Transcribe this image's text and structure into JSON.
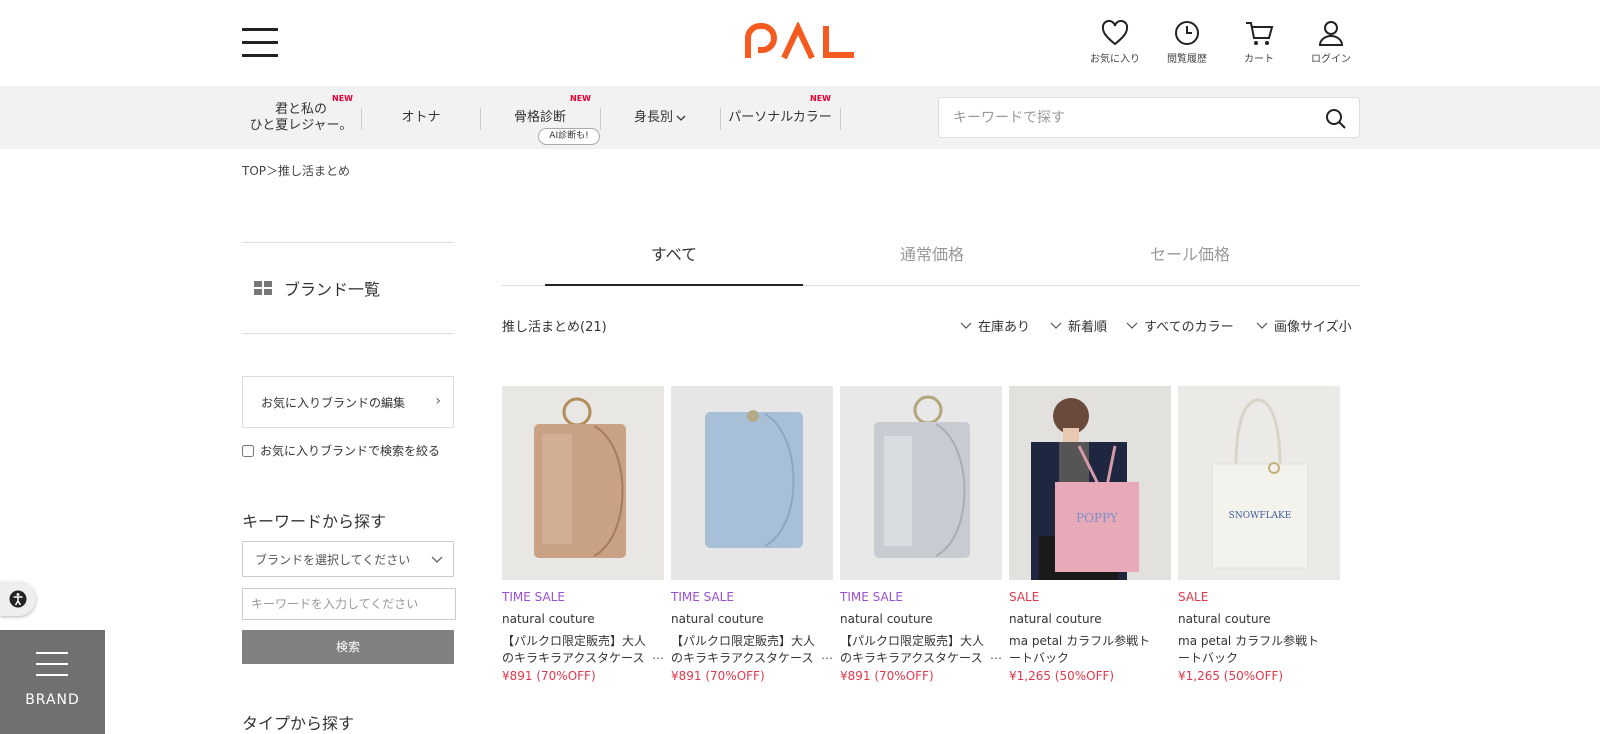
{
  "header": {
    "logo_text": "PAL",
    "icons": [
      {
        "name": "favorite",
        "label": "お気に入り"
      },
      {
        "name": "history",
        "label": "閲覧履歴"
      },
      {
        "name": "cart",
        "label": "カート"
      },
      {
        "name": "login",
        "label": "ログイン"
      }
    ]
  },
  "nav": {
    "items": [
      {
        "label": "君と私の\nひと夏レジャー。",
        "new": true
      },
      {
        "label": "オトナ",
        "new": false
      },
      {
        "label": "骨格診断",
        "new": true
      },
      {
        "label": "身長別",
        "new": false
      },
      {
        "label": "パーソナルカラー",
        "new": true
      }
    ],
    "new_label": "NEW",
    "ai_badge": "AI診断も!",
    "search_placeholder": "キーワードで探す"
  },
  "breadcrumb": "TOP＞推し活まとめ",
  "sidebar": {
    "brand_list": "ブランド一覧",
    "fav_edit": "お気に入りブランドの編集",
    "fav_filter": "お気に入りブランドで検索を絞る",
    "keyword_heading": "キーワードから探す",
    "brand_select_placeholder": "ブランドを選択してください",
    "keyword_placeholder": "キーワードを入力してください",
    "search_button": "検索",
    "type_heading": "タイプから探す"
  },
  "fab": {
    "brand_label": "BRAND"
  },
  "tabs": [
    "すべて",
    "通常価格",
    "セール価格"
  ],
  "result_count": "推し活まとめ(21)",
  "filters": [
    "在庫あり",
    "新着順",
    "すべてのカラー",
    "画像サイズ小"
  ],
  "products": [
    {
      "tag": "TIME SALE",
      "tag_type": "ts",
      "brand": "natural couture",
      "name": "【パルクロ限定販売】大人のキラキラアクスタケース",
      "price": "¥891 (70%OFF)",
      "image": "rose-gold-card-case",
      "color": "#c9a184"
    },
    {
      "tag": "TIME SALE",
      "tag_type": "ts",
      "brand": "natural couture",
      "name": "【パルクロ限定販売】大人のキラキラアクスタケース",
      "price": "¥891 (70%OFF)",
      "image": "blue-card-case",
      "color": "#a8bfd8"
    },
    {
      "tag": "TIME SALE",
      "tag_type": "ts",
      "brand": "natural couture",
      "name": "【パルクロ限定販売】大人のキラキラアクスタケース",
      "price": "¥891 (70%OFF)",
      "image": "silver-card-case",
      "color": "#c8ccd2"
    },
    {
      "tag": "SALE",
      "tag_type": "s",
      "brand": "natural couture",
      "name": "ma petal カラフル参戦トートバック",
      "price": "¥1,265 (50%OFF)",
      "image": "pink-tote-model",
      "color": "#e8aab8"
    },
    {
      "tag": "SALE",
      "tag_type": "s",
      "brand": "natural couture",
      "name": "ma petal カラフル参戦トートバック",
      "price": "¥1,265 (50%OFF)",
      "image": "white-tote-snowflake",
      "color": "#f2efe6"
    }
  ],
  "product_image_text": {
    "pink-tote-model": "POPPY",
    "white-tote-snowflake": "SNOWFLAKE"
  }
}
